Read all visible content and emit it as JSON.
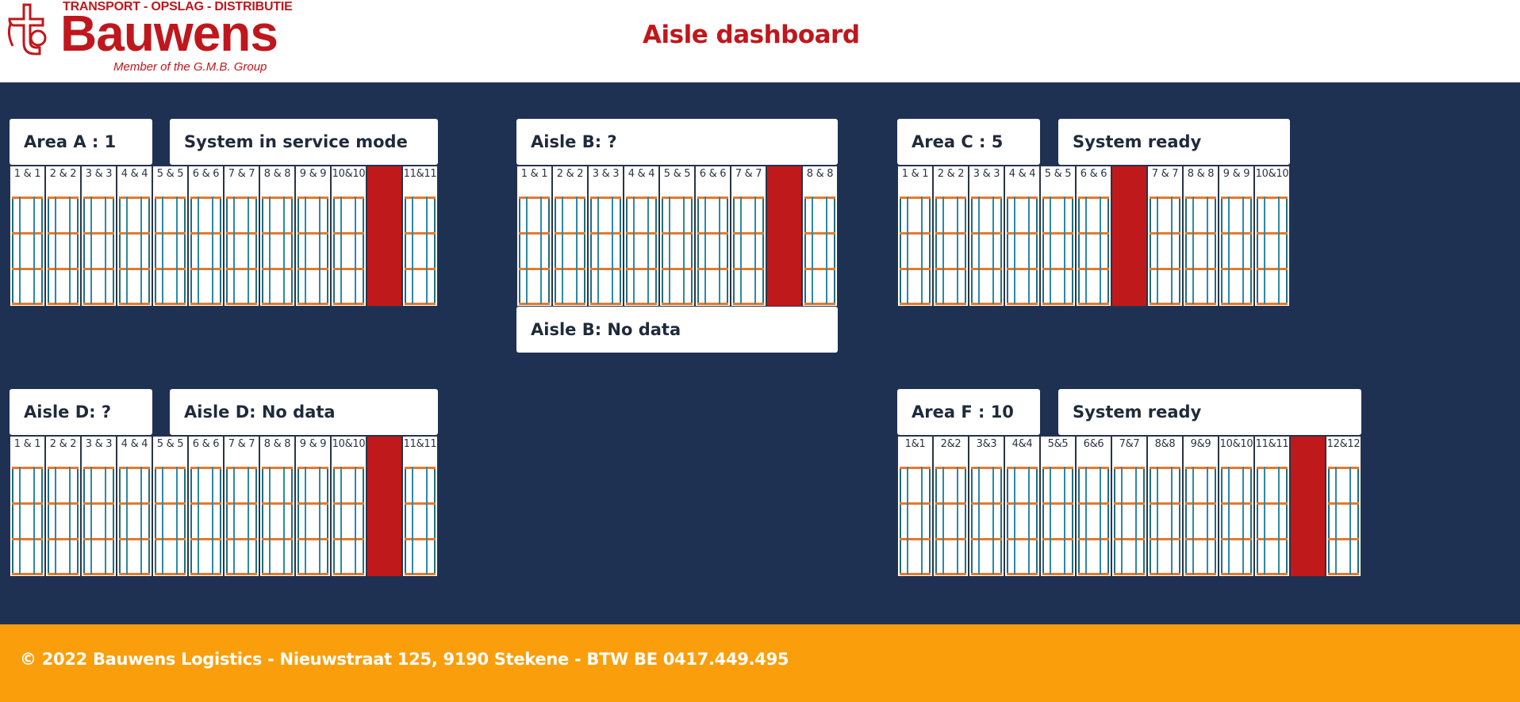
{
  "header": {
    "logo": {
      "tagline": "TRANSPORT - OPSLAG - DISTRIBUTIE",
      "name": "Bauwens",
      "member": "Member of the G.M.B. Group"
    },
    "title": "Aisle dashboard"
  },
  "colors": {
    "brand_red": "#c0171c",
    "background_navy": "#1f3153",
    "footer_orange": "#fb9e0b",
    "beam_orange": "#e57a2a",
    "upright_teal": "#1f6d84",
    "blocked_red": "#c0191b"
  },
  "areas": [
    {
      "id": "A",
      "labels": [
        "Area A : 1",
        "System in service mode"
      ],
      "bays": [
        "1 & 1",
        "2 & 2",
        "3 & 3",
        "4 & 4",
        "5 & 5",
        "6 & 6",
        "7 & 7",
        "8 & 8",
        "9 & 9",
        "10&10",
        "",
        "11&11"
      ],
      "red_index": 10
    },
    {
      "id": "B",
      "labels": [
        "Aisle B: ?",
        "Aisle B: No data"
      ],
      "bays": [
        "1 & 1",
        "2 & 2",
        "3 & 3",
        "4 & 4",
        "5 & 5",
        "6 & 6",
        "7 & 7",
        "",
        "8 & 8"
      ],
      "red_index": 7
    },
    {
      "id": "C",
      "labels": [
        "Area C : 5",
        "System ready"
      ],
      "bays": [
        "1 & 1",
        "2 & 2",
        "3 & 3",
        "4 & 4",
        "5 & 5",
        "6 & 6",
        "",
        "7 & 7",
        "8 & 8",
        "9 & 9",
        "10&10"
      ],
      "red_index": 6
    },
    {
      "id": "D",
      "labels": [
        "Aisle D: ?",
        "Aisle D: No data"
      ],
      "bays": [
        "1 & 1",
        "2 & 2",
        "3 & 3",
        "4 & 4",
        "5 & 5",
        "6 & 6",
        "7 & 7",
        "8 & 8",
        "9 & 9",
        "10&10",
        "",
        "11&11"
      ],
      "red_index": 10
    },
    {
      "id": "F",
      "labels": [
        "Area F : 10",
        "System ready"
      ],
      "bays": [
        "1&1",
        "2&2",
        "3&3",
        "4&4",
        "5&5",
        "6&6",
        "7&7",
        "8&8",
        "9&9",
        "10&10",
        "11&11",
        "",
        "12&12"
      ],
      "red_index": 11
    }
  ],
  "footer": {
    "text": "© 2022 Bauwens Logistics - Nieuwstraat 125, 9190 Stekene - BTW BE 0417.449.495"
  }
}
